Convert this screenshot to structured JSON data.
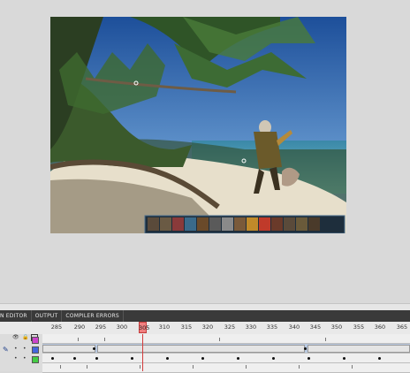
{
  "timeline": {
    "tabs": [
      "N EDITOR",
      "OUTPUT",
      "COMPILER ERRORS"
    ],
    "ruler_labels": [
      "285",
      "290",
      "295",
      "300",
      "305",
      "310",
      "315",
      "320",
      "325",
      "330",
      "335",
      "340",
      "345",
      "350",
      "355",
      "360",
      "365"
    ],
    "current_frame": "305"
  },
  "layer_colors": [
    "#cc44cc",
    "#4466dd",
    "#44cc44"
  ],
  "icons": [
    "eye-icon",
    "lock-icon",
    "outline-icon",
    "pencil-icon"
  ],
  "scene": {
    "description_icons": [
      "potion-icon",
      "sword-icon",
      "shield-icon",
      "rune-icon",
      "fire-icon",
      "star-icon",
      "coin-icon",
      "bomb-icon",
      "staff-icon"
    ]
  }
}
